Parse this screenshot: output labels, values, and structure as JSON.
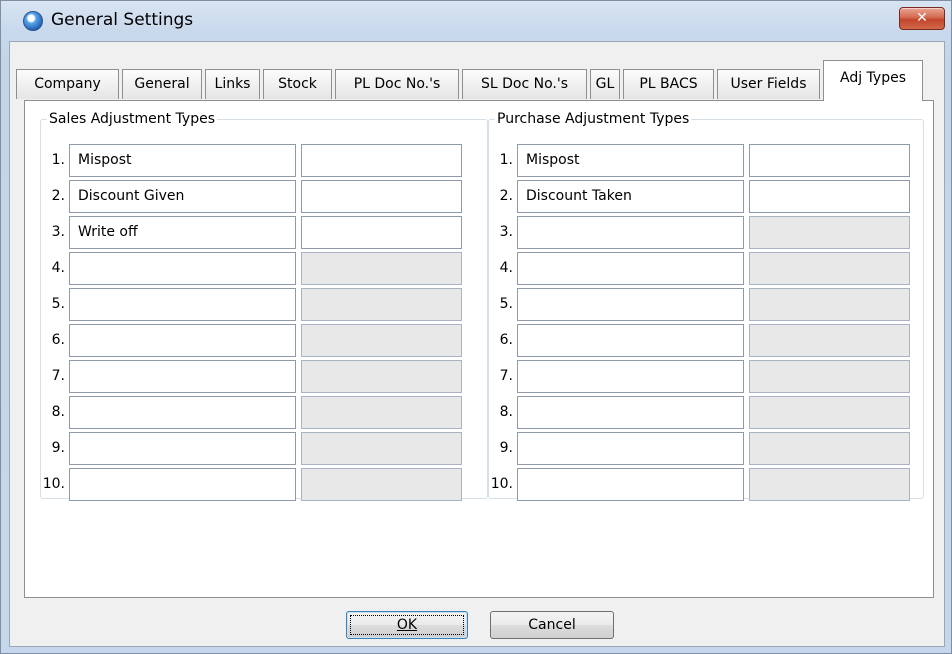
{
  "window": {
    "title": "General Settings",
    "close_glyph": "✕"
  },
  "tabs": [
    "Company",
    "General",
    "Links",
    "Stock",
    "PL Doc No.'s",
    "SL Doc No.'s",
    "GL",
    "PL BACS",
    "User Fields",
    "Adj Types"
  ],
  "active_tab": "Adj Types",
  "sales": {
    "legend": "Sales Adjustment Types",
    "rows": [
      {
        "num": "1.",
        "name": "Mispost",
        "enabled": true
      },
      {
        "num": "2.",
        "name": "Discount Given",
        "enabled": true
      },
      {
        "num": "3.",
        "name": "Write off",
        "enabled": true
      },
      {
        "num": "4.",
        "name": "",
        "enabled": false
      },
      {
        "num": "5.",
        "name": "",
        "enabled": false
      },
      {
        "num": "6.",
        "name": "",
        "enabled": false
      },
      {
        "num": "7.",
        "name": "",
        "enabled": false
      },
      {
        "num": "8.",
        "name": "",
        "enabled": false
      },
      {
        "num": "9.",
        "name": "",
        "enabled": false
      },
      {
        "num": "10.",
        "name": "",
        "enabled": false
      }
    ]
  },
  "purchase": {
    "legend": "Purchase Adjustment Types",
    "rows": [
      {
        "num": "1.",
        "name": "Mispost",
        "enabled": true
      },
      {
        "num": "2.",
        "name": "Discount Taken",
        "enabled": true
      },
      {
        "num": "3.",
        "name": "",
        "enabled": false
      },
      {
        "num": "4.",
        "name": "",
        "enabled": false
      },
      {
        "num": "5.",
        "name": "",
        "enabled": false
      },
      {
        "num": "6.",
        "name": "",
        "enabled": false
      },
      {
        "num": "7.",
        "name": "",
        "enabled": false
      },
      {
        "num": "8.",
        "name": "",
        "enabled": false
      },
      {
        "num": "9.",
        "name": "",
        "enabled": false
      },
      {
        "num": "10.",
        "name": "",
        "enabled": false
      }
    ]
  },
  "buttons": {
    "ok": "OK",
    "cancel": "Cancel"
  },
  "icons": {
    "app": "app-globe-icon",
    "close": "close-icon"
  },
  "colors": {
    "close_button": "#c2452c",
    "disabled_field": "#e8e8e8",
    "titlebar": "#c9d9ec"
  }
}
